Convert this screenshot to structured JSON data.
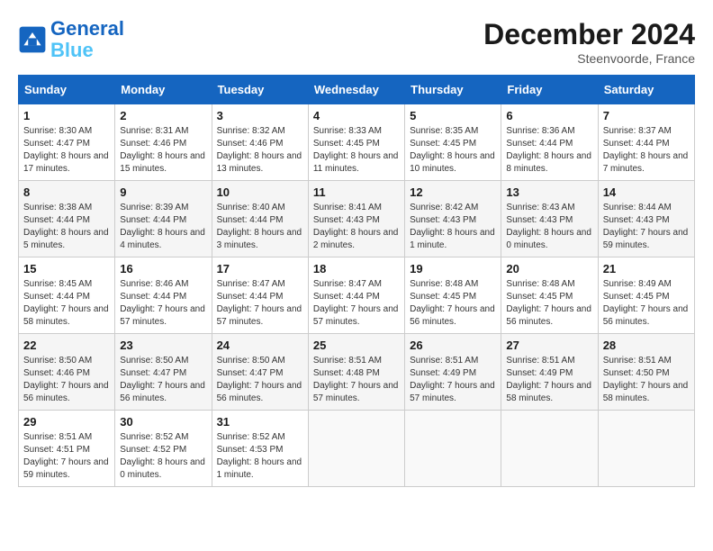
{
  "header": {
    "logo_line1": "General",
    "logo_line2": "Blue",
    "month": "December 2024",
    "location": "Steenvoorde, France"
  },
  "weekdays": [
    "Sunday",
    "Monday",
    "Tuesday",
    "Wednesday",
    "Thursday",
    "Friday",
    "Saturday"
  ],
  "weeks": [
    [
      {
        "day": "1",
        "sunrise": "8:30 AM",
        "sunset": "4:47 PM",
        "daylight": "8 hours and 17 minutes."
      },
      {
        "day": "2",
        "sunrise": "8:31 AM",
        "sunset": "4:46 PM",
        "daylight": "8 hours and 15 minutes."
      },
      {
        "day": "3",
        "sunrise": "8:32 AM",
        "sunset": "4:46 PM",
        "daylight": "8 hours and 13 minutes."
      },
      {
        "day": "4",
        "sunrise": "8:33 AM",
        "sunset": "4:45 PM",
        "daylight": "8 hours and 11 minutes."
      },
      {
        "day": "5",
        "sunrise": "8:35 AM",
        "sunset": "4:45 PM",
        "daylight": "8 hours and 10 minutes."
      },
      {
        "day": "6",
        "sunrise": "8:36 AM",
        "sunset": "4:44 PM",
        "daylight": "8 hours and 8 minutes."
      },
      {
        "day": "7",
        "sunrise": "8:37 AM",
        "sunset": "4:44 PM",
        "daylight": "8 hours and 7 minutes."
      }
    ],
    [
      {
        "day": "8",
        "sunrise": "8:38 AM",
        "sunset": "4:44 PM",
        "daylight": "8 hours and 5 minutes."
      },
      {
        "day": "9",
        "sunrise": "8:39 AM",
        "sunset": "4:44 PM",
        "daylight": "8 hours and 4 minutes."
      },
      {
        "day": "10",
        "sunrise": "8:40 AM",
        "sunset": "4:44 PM",
        "daylight": "8 hours and 3 minutes."
      },
      {
        "day": "11",
        "sunrise": "8:41 AM",
        "sunset": "4:43 PM",
        "daylight": "8 hours and 2 minutes."
      },
      {
        "day": "12",
        "sunrise": "8:42 AM",
        "sunset": "4:43 PM",
        "daylight": "8 hours and 1 minute."
      },
      {
        "day": "13",
        "sunrise": "8:43 AM",
        "sunset": "4:43 PM",
        "daylight": "8 hours and 0 minutes."
      },
      {
        "day": "14",
        "sunrise": "8:44 AM",
        "sunset": "4:43 PM",
        "daylight": "7 hours and 59 minutes."
      }
    ],
    [
      {
        "day": "15",
        "sunrise": "8:45 AM",
        "sunset": "4:44 PM",
        "daylight": "7 hours and 58 minutes."
      },
      {
        "day": "16",
        "sunrise": "8:46 AM",
        "sunset": "4:44 PM",
        "daylight": "7 hours and 57 minutes."
      },
      {
        "day": "17",
        "sunrise": "8:47 AM",
        "sunset": "4:44 PM",
        "daylight": "7 hours and 57 minutes."
      },
      {
        "day": "18",
        "sunrise": "8:47 AM",
        "sunset": "4:44 PM",
        "daylight": "7 hours and 57 minutes."
      },
      {
        "day": "19",
        "sunrise": "8:48 AM",
        "sunset": "4:45 PM",
        "daylight": "7 hours and 56 minutes."
      },
      {
        "day": "20",
        "sunrise": "8:48 AM",
        "sunset": "4:45 PM",
        "daylight": "7 hours and 56 minutes."
      },
      {
        "day": "21",
        "sunrise": "8:49 AM",
        "sunset": "4:45 PM",
        "daylight": "7 hours and 56 minutes."
      }
    ],
    [
      {
        "day": "22",
        "sunrise": "8:50 AM",
        "sunset": "4:46 PM",
        "daylight": "7 hours and 56 minutes."
      },
      {
        "day": "23",
        "sunrise": "8:50 AM",
        "sunset": "4:47 PM",
        "daylight": "7 hours and 56 minutes."
      },
      {
        "day": "24",
        "sunrise": "8:50 AM",
        "sunset": "4:47 PM",
        "daylight": "7 hours and 56 minutes."
      },
      {
        "day": "25",
        "sunrise": "8:51 AM",
        "sunset": "4:48 PM",
        "daylight": "7 hours and 57 minutes."
      },
      {
        "day": "26",
        "sunrise": "8:51 AM",
        "sunset": "4:49 PM",
        "daylight": "7 hours and 57 minutes."
      },
      {
        "day": "27",
        "sunrise": "8:51 AM",
        "sunset": "4:49 PM",
        "daylight": "7 hours and 58 minutes."
      },
      {
        "day": "28",
        "sunrise": "8:51 AM",
        "sunset": "4:50 PM",
        "daylight": "7 hours and 58 minutes."
      }
    ],
    [
      {
        "day": "29",
        "sunrise": "8:51 AM",
        "sunset": "4:51 PM",
        "daylight": "7 hours and 59 minutes."
      },
      {
        "day": "30",
        "sunrise": "8:52 AM",
        "sunset": "4:52 PM",
        "daylight": "8 hours and 0 minutes."
      },
      {
        "day": "31",
        "sunrise": "8:52 AM",
        "sunset": "4:53 PM",
        "daylight": "8 hours and 1 minute."
      },
      null,
      null,
      null,
      null
    ]
  ]
}
